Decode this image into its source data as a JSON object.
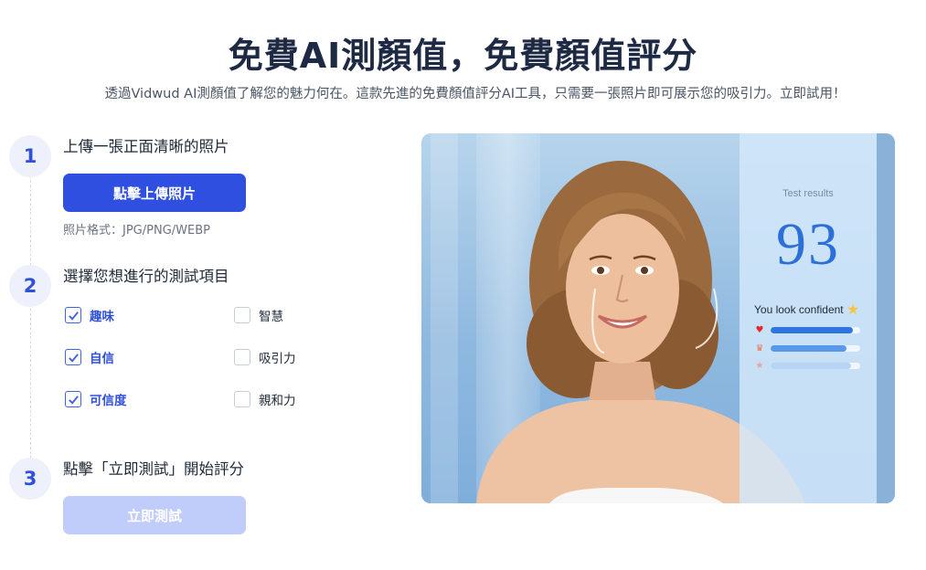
{
  "header": {
    "title": "免費AI測顏值，免費顏值評分",
    "subtitle": "透過Vidwud AI測顏值了解您的魅力何在。這款先進的免費顏值評分AI工具，只需要一張照片即可展示您的吸引力。立即試用！"
  },
  "steps": [
    {
      "number": "1",
      "label": "上傳一張正面清晰的照片"
    },
    {
      "number": "2",
      "label": "選擇您想進行的測試項目"
    },
    {
      "number": "3",
      "label": "點擊「立即測試」開始評分"
    }
  ],
  "upload": {
    "button_label": "點擊上傳照片",
    "format_note": "照片格式：JPG/PNG/WEBP"
  },
  "options": [
    {
      "label": "趣味",
      "checked": true
    },
    {
      "label": "智慧",
      "checked": false
    },
    {
      "label": "自信",
      "checked": true
    },
    {
      "label": "吸引力",
      "checked": false
    },
    {
      "label": "可信度",
      "checked": true
    },
    {
      "label": "親和力",
      "checked": false
    }
  ],
  "test_button_label": "立即測試",
  "preview": {
    "results_label": "Test results",
    "score": "93",
    "message": "You look confident",
    "bars": [
      {
        "icon": "heart-icon",
        "color": "#e5262b",
        "fill": 0.92
      },
      {
        "icon": "crown-icon",
        "color": "#e8785c",
        "fill": 0.85
      },
      {
        "icon": "star-icon",
        "color": "#e9a0a8",
        "fill": 0.9
      }
    ]
  },
  "colors": {
    "primary": "#2f4fe0",
    "primary_disabled": "#c0ccfa",
    "step_badge_bg": "#eef1fb",
    "accent_text": "#2f50d8"
  }
}
